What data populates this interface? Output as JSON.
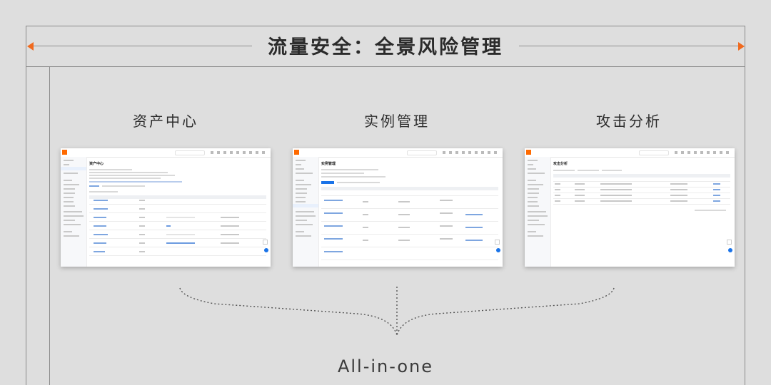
{
  "title": "流量安全：全景风险管理",
  "sections": [
    {
      "label": "资产中心",
      "screenshot_title": "资产中心"
    },
    {
      "label": "实例管理",
      "screenshot_title": "实例管理"
    },
    {
      "label": "攻击分析",
      "screenshot_title": "攻击分析"
    }
  ],
  "footer": "All-in-one",
  "colors": {
    "accent": "#f06a1e",
    "background": "#dedede",
    "brand": "#ff6a00",
    "link": "#1a73e8"
  },
  "icons": [
    "arrow-left-icon",
    "arrow-right-icon",
    "logo-icon",
    "search-icon"
  ]
}
